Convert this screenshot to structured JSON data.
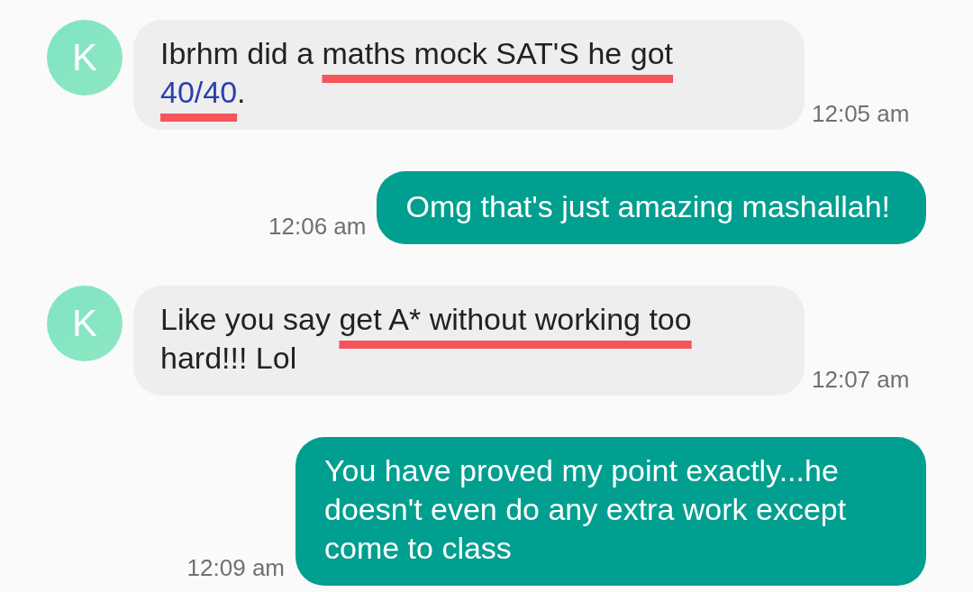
{
  "messages": [
    {
      "kind": "incoming",
      "avatar": "K",
      "time": "12:05 am",
      "segments": [
        {
          "text": "Ibrhm did a ",
          "kind": "plain"
        },
        {
          "text": "maths mock SAT'S he got ",
          "kind": "plain",
          "scribbled": true
        },
        {
          "text": "40/40",
          "kind": "link",
          "scribbled": true
        },
        {
          "text": ".",
          "kind": "plain"
        }
      ]
    },
    {
      "kind": "outgoing",
      "time": "12:06 am",
      "segments": [
        {
          "text": "Omg that's just amazing mashallah!",
          "kind": "plain"
        }
      ]
    },
    {
      "kind": "incoming",
      "avatar": "K",
      "time": "12:07 am",
      "segments": [
        {
          "text": "Like you say ",
          "kind": "plain"
        },
        {
          "text": "get A* without working too",
          "kind": "plain",
          "scribbled": true
        },
        {
          "text": " hard!!! Lol",
          "kind": "plain"
        }
      ]
    },
    {
      "kind": "outgoing",
      "time": "12:09 am",
      "segments": [
        {
          "text": "You have proved my point exactly...he doesn't even do any extra work except come to class",
          "kind": "plain"
        }
      ]
    }
  ]
}
